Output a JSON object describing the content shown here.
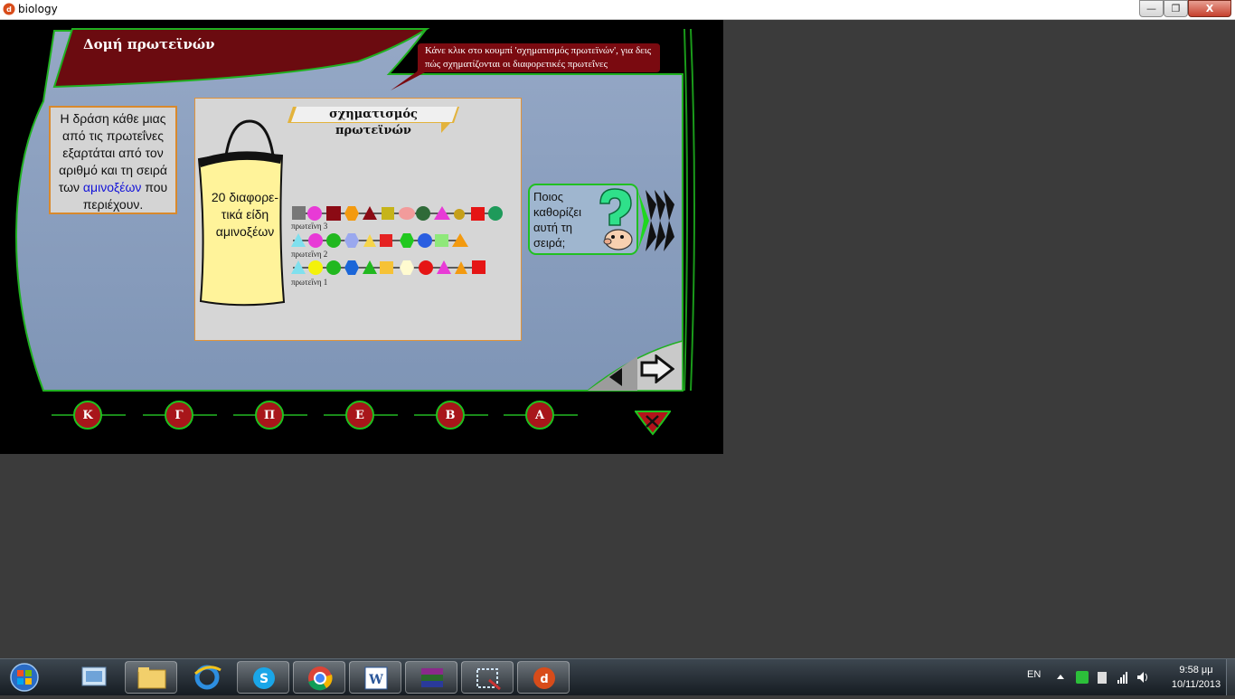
{
  "window": {
    "title": "biology",
    "minimize": "—",
    "maximize": "❐",
    "close": "X"
  },
  "lesson": {
    "page_title": "Δομή πρωτεϊνών",
    "hint": "Κάνε κλικ στο κουμπί 'σχηματισμός πρωτεϊνών', για δεις πώς σχηματίζονται οι διαφορετικές πρωτεΐνες",
    "intro": {
      "text_before": "Η δράση κάθε μιας από τις πρωτεΐνες εξαρτάται από τον αριθμό και τη σειρά των ",
      "keyword": "αμινοξέων",
      "text_after": " που περιέχουν."
    },
    "panel": {
      "button_label": "σχηματισμός πρωτεϊνών",
      "bag_label": "20 διαφορε-τικά είδη αμινοξέων",
      "proteins": [
        {
          "label": "πρωτεΐνη 3"
        },
        {
          "label": "πρωτεΐνη 2"
        },
        {
          "label": "πρωτεΐνη 1"
        }
      ]
    },
    "question": "Ποιος καθορίζει αυτή τη σειρά;",
    "nav_letters": [
      "Κ",
      "Γ",
      "Π",
      "Ε",
      "Β",
      "Α"
    ],
    "colors": {
      "banner": "#6b0b10",
      "accent_green": "#1fc21f",
      "stage_blue": "#8398ba",
      "keyword_blue": "#1414d8"
    }
  },
  "taskbar": {
    "apps": [
      "explorer-photos",
      "windows-explorer",
      "internet-explorer",
      "skype",
      "chrome",
      "word",
      "winrar",
      "snipping-tool",
      "biology-app"
    ],
    "language": "EN",
    "time": "9:58 μμ",
    "date": "10/11/2013"
  }
}
